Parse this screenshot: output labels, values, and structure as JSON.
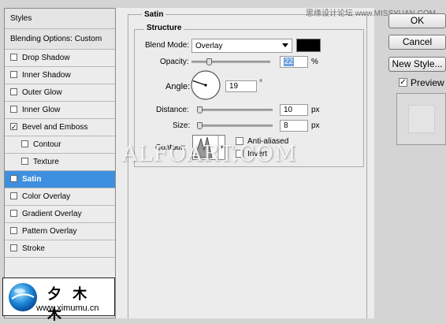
{
  "left_panel": {
    "styles_label": "Styles",
    "blending_label": "Blending Options: Custom",
    "items": [
      {
        "label": "Drop Shadow",
        "checked": false
      },
      {
        "label": "Inner Shadow",
        "checked": false
      },
      {
        "label": "Outer Glow",
        "checked": false
      },
      {
        "label": "Inner Glow",
        "checked": false
      },
      {
        "label": "Bevel and Emboss",
        "checked": true
      },
      {
        "label": "Contour",
        "checked": false
      },
      {
        "label": "Texture",
        "checked": false
      },
      {
        "label": "Satin",
        "checked": true
      },
      {
        "label": "Color Overlay",
        "checked": false
      },
      {
        "label": "Gradient Overlay",
        "checked": false
      },
      {
        "label": "Pattern Overlay",
        "checked": false
      },
      {
        "label": "Stroke",
        "checked": false
      }
    ],
    "check_glyph": "✓"
  },
  "satin": {
    "title": "Satin",
    "structure": {
      "title": "Structure",
      "blend_mode_label": "Blend Mode:",
      "blend_mode_value": "Overlay",
      "blend_color": "#000000",
      "opacity_label": "Opacity:",
      "opacity_value": "22",
      "opacity_unit": "%",
      "opacity_fraction": 0.22,
      "angle_label": "Angle:",
      "angle_value": "19",
      "angle_unit": "°",
      "angle_degrees": 19,
      "distance_label": "Distance:",
      "distance_value": "10",
      "distance_unit": "px",
      "distance_fraction": 0.03,
      "size_label": "Size:",
      "size_value": "8",
      "size_unit": "px",
      "size_fraction": 0.03,
      "contour_label": "Contour:",
      "anti_aliased_label": "Anti-aliased",
      "invert_label": "Invert"
    }
  },
  "right_panel": {
    "ok_label": "OK",
    "cancel_label": "Cancel",
    "new_style_label": "New Style...",
    "preview_label": "Preview",
    "preview_checked": true
  },
  "watermarks": {
    "center": "ALFOART.COM",
    "top_right": "思缘设计论坛 www.MISSYUAN.COM",
    "logo_chars": "夕 木 木",
    "logo_url": "www.ximumu.cn"
  },
  "colors": {
    "selected": "#3d8fe0",
    "panel": "#ececec"
  }
}
